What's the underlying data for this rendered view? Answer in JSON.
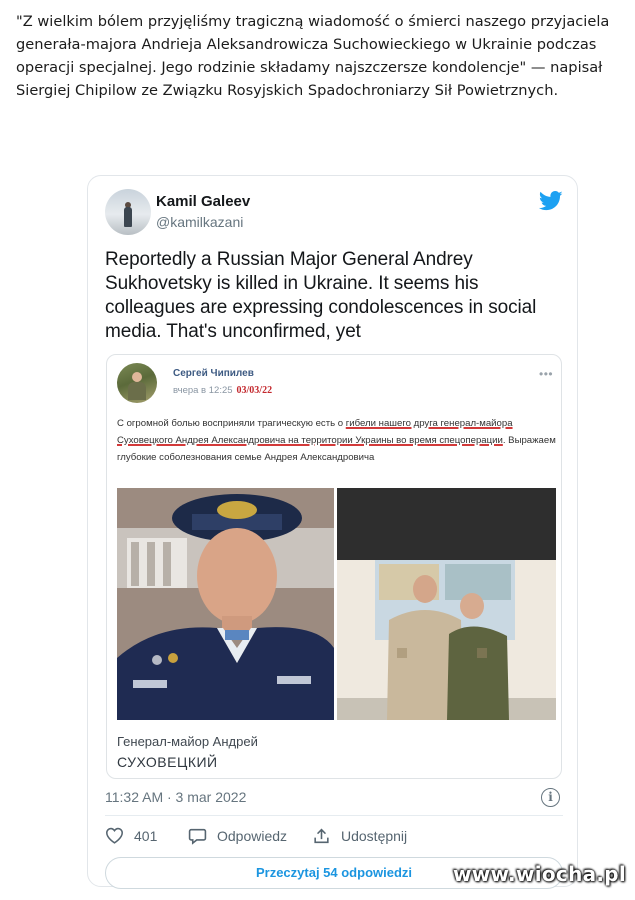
{
  "caption": "\"Z wielkim bólem przyjęliśmy tragiczną wiadomość o śmierci naszego przyjaciela generała-majora Andrieja Aleksandrowicza Suchowieckiego w Ukrainie podczas operacji specjalnej. Jego rodzinie składamy najszczersze kondolencje\" — napisał Siergiej Chipilow ze Związku Rosyjskich Spadochroniarzy Sił Powietrznych.",
  "tweet": {
    "author_name": "Kamil Galeev",
    "author_handle": "@kamilkazani",
    "text": "Reportedly a Russian Major General Andrey Sukhovetsky is killed in Ukraine. It seems his colleagues are expressing condolescences in social media. That's unconfirmed, yet",
    "timestamp": "11:32 AM · 3 mar 2022",
    "likes": "401",
    "reply_label": "Odpowiedz",
    "share_label": "Udostępnij",
    "read_replies": "Przeczytaj 54 odpowiedzi",
    "brand_color": "#1da1f2"
  },
  "embedded": {
    "author": "Сергей Чипилев",
    "time": "вчера в 12:25",
    "date_note": "03/03/22",
    "text_plain1": "С огромной болью восприняли трагическую есть о ",
    "text_underlined": "гибели нашего друга генерал-майора Суховецкого Андрея Александровича на территории Украины во время спецоперации",
    "text_plain2": ". Выражаем глубокие соболезнования семье Андрея Александровича",
    "photo_caption_line1": "Генерал-майор Андрей",
    "photo_caption_line2": "СУХОВЕЦКИЙ"
  },
  "watermark": "www.wiocha.pl",
  "icons": [
    "twitter-bird-icon",
    "heart-icon",
    "reply-bubble-icon",
    "share-icon",
    "info-icon",
    "more-dots-icon"
  ]
}
